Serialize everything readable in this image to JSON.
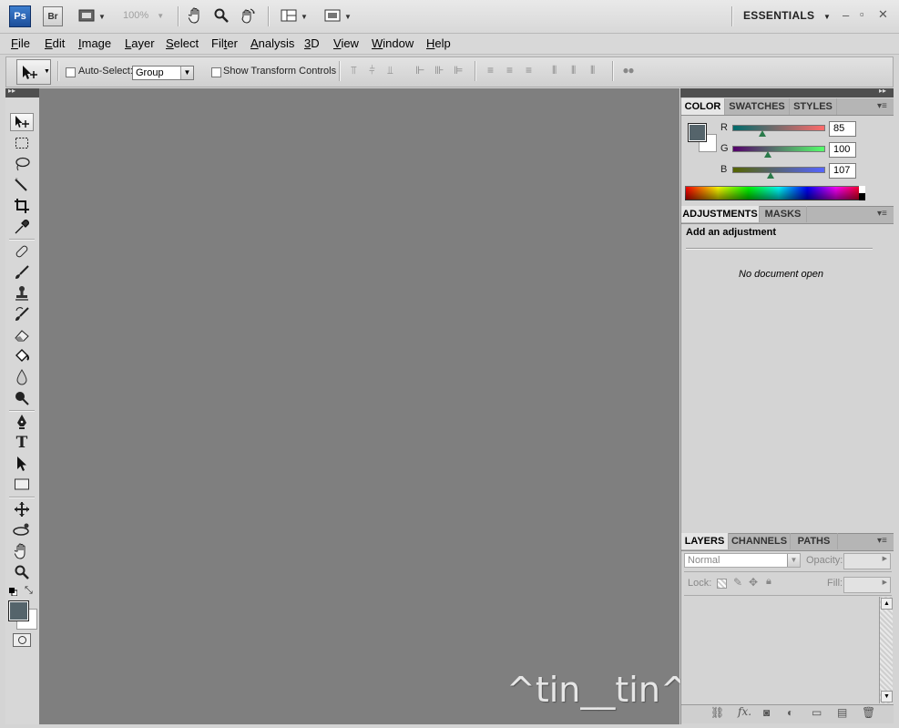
{
  "appbar": {
    "ps_logo": "Ps",
    "br_logo": "Br",
    "zoom": "100%",
    "workspace": "ESSENTIALS"
  },
  "menu": [
    "File",
    "Edit",
    "Image",
    "Layer",
    "Select",
    "Filter",
    "Analysis",
    "3D",
    "View",
    "Window",
    "Help"
  ],
  "menu_underline": [
    "F",
    "E",
    "I",
    "L",
    "S",
    "t",
    "A",
    "3",
    "V",
    "W",
    "H"
  ],
  "options": {
    "auto_select_label": "Auto-Select:",
    "auto_select_value": "Group",
    "show_transform_label": "Show Transform Controls"
  },
  "color_panel": {
    "tabs": [
      "COLOR",
      "SWATCHES",
      "STYLES"
    ],
    "channels": [
      {
        "label": "R",
        "value": "85",
        "fraction": 0.33
      },
      {
        "label": "G",
        "value": "100",
        "fraction": 0.39
      },
      {
        "label": "B",
        "value": "107",
        "fraction": 0.42
      }
    ],
    "foreground": "#55646b",
    "background": "#ffffff"
  },
  "adjustments_panel": {
    "tabs": [
      "ADJUSTMENTS",
      "MASKS"
    ],
    "heading": "Add an adjustment",
    "status": "No document open"
  },
  "layers_panel": {
    "tabs": [
      "LAYERS",
      "CHANNELS",
      "PATHS"
    ],
    "blend_mode": "Normal",
    "opacity_label": "Opacity:",
    "lock_label": "Lock:",
    "fill_label": "Fill:"
  },
  "watermark": "^tin__tin^",
  "icons": {
    "toolbar": [
      "hand-icon",
      "zoom-icon",
      "rotate-view-icon",
      "arrange-documents-icon",
      "screen-mode-icon"
    ]
  }
}
